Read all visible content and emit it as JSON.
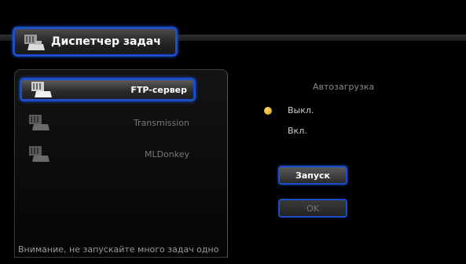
{
  "header": {
    "title": "Диспетчер задач",
    "icon": "task-manager-icon"
  },
  "tasks": {
    "items": [
      {
        "label": "FTP-сервер",
        "icon": "server-icon",
        "selected": true
      },
      {
        "label": "Transmission",
        "icon": "server-icon",
        "selected": false
      },
      {
        "label": "MLDonkey",
        "icon": "server-icon",
        "selected": false
      }
    ],
    "warning": "Внимание, не запускайте много задач одно"
  },
  "autoload": {
    "title": "Автозагрузка",
    "options": [
      {
        "label": "Выкл.",
        "selected": true
      },
      {
        "label": "Вкл.",
        "selected": false
      }
    ]
  },
  "buttons": {
    "start": "Запуск",
    "ok": "OK"
  },
  "colors": {
    "accent": "#1b4ec9",
    "radio": "#e6a91c"
  }
}
